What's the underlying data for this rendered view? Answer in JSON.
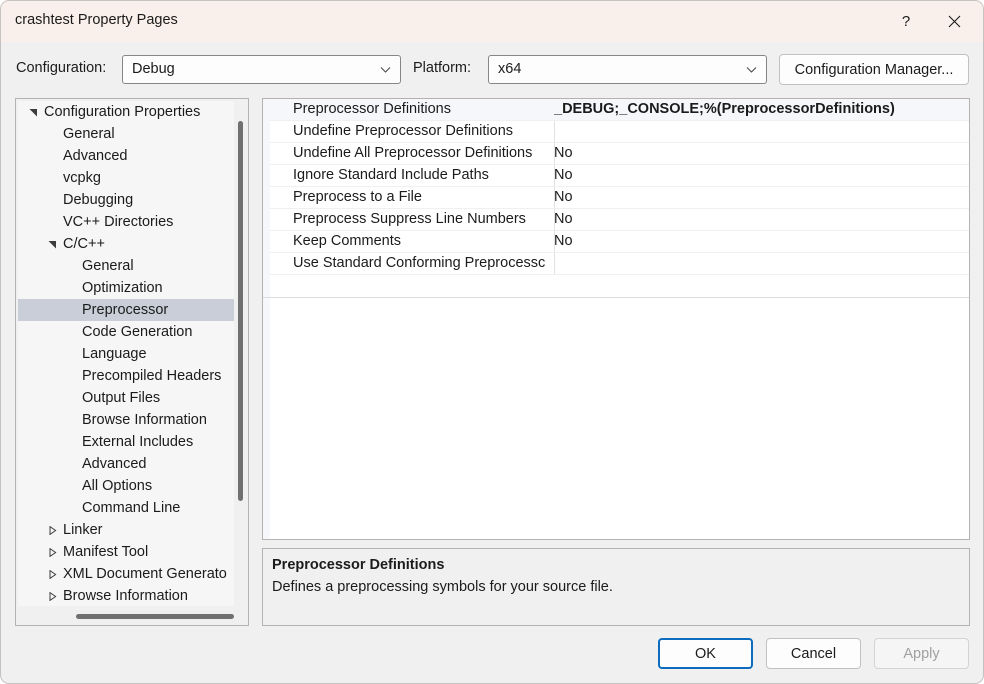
{
  "window": {
    "title": "crashtest Property Pages",
    "help_icon": "question-mark-icon",
    "close_icon": "close-icon"
  },
  "toolbar": {
    "configuration_label": "Configuration:",
    "configuration_value": "Debug",
    "platform_label": "Platform:",
    "platform_value": "x64",
    "configuration_manager_label": "Configuration Manager..."
  },
  "tree": {
    "items": [
      {
        "label": "Configuration Properties",
        "indent": 0,
        "expander": "expanded"
      },
      {
        "label": "General",
        "indent": 1,
        "expander": "none"
      },
      {
        "label": "Advanced",
        "indent": 1,
        "expander": "none"
      },
      {
        "label": "vcpkg",
        "indent": 1,
        "expander": "none"
      },
      {
        "label": "Debugging",
        "indent": 1,
        "expander": "none"
      },
      {
        "label": "VC++ Directories",
        "indent": 1,
        "expander": "none"
      },
      {
        "label": "C/C++",
        "indent": 1,
        "expander": "expanded"
      },
      {
        "label": "General",
        "indent": 2,
        "expander": "none"
      },
      {
        "label": "Optimization",
        "indent": 2,
        "expander": "none"
      },
      {
        "label": "Preprocessor",
        "indent": 2,
        "expander": "none",
        "selected": true
      },
      {
        "label": "Code Generation",
        "indent": 2,
        "expander": "none"
      },
      {
        "label": "Language",
        "indent": 2,
        "expander": "none"
      },
      {
        "label": "Precompiled Headers",
        "indent": 2,
        "expander": "none"
      },
      {
        "label": "Output Files",
        "indent": 2,
        "expander": "none"
      },
      {
        "label": "Browse Information",
        "indent": 2,
        "expander": "none"
      },
      {
        "label": "External Includes",
        "indent": 2,
        "expander": "none"
      },
      {
        "label": "Advanced",
        "indent": 2,
        "expander": "none"
      },
      {
        "label": "All Options",
        "indent": 2,
        "expander": "none"
      },
      {
        "label": "Command Line",
        "indent": 2,
        "expander": "none"
      },
      {
        "label": "Linker",
        "indent": 1,
        "expander": "collapsed"
      },
      {
        "label": "Manifest Tool",
        "indent": 1,
        "expander": "collapsed"
      },
      {
        "label": "XML Document Generato",
        "indent": 1,
        "expander": "collapsed"
      },
      {
        "label": "Browse Information",
        "indent": 1,
        "expander": "collapsed"
      }
    ]
  },
  "grid": {
    "rows": [
      {
        "name": "Preprocessor Definitions",
        "value": "_DEBUG;_CONSOLE;%(PreprocessorDefinitions)",
        "selected": true
      },
      {
        "name": "Undefine Preprocessor Definitions",
        "value": ""
      },
      {
        "name": "Undefine All Preprocessor Definitions",
        "value": "No"
      },
      {
        "name": "Ignore Standard Include Paths",
        "value": "No"
      },
      {
        "name": "Preprocess to a File",
        "value": "No"
      },
      {
        "name": "Preprocess Suppress Line Numbers",
        "value": "No"
      },
      {
        "name": "Keep Comments",
        "value": "No"
      },
      {
        "name": "Use Standard Conforming Preprocessc",
        "value": ""
      }
    ]
  },
  "description": {
    "title": "Preprocessor Definitions",
    "body": "Defines a preprocessing symbols for your source file."
  },
  "footer": {
    "ok_label": "OK",
    "cancel_label": "Cancel",
    "apply_label": "Apply"
  },
  "colors": {
    "titlebar": "#f9f0ec",
    "body": "#f0f0f0",
    "tree_selection": "#c9ced9",
    "grid_selection": "#f5f7fa",
    "default_button_border": "#0d6cbe",
    "disabled_text": "#a0a0a0"
  }
}
